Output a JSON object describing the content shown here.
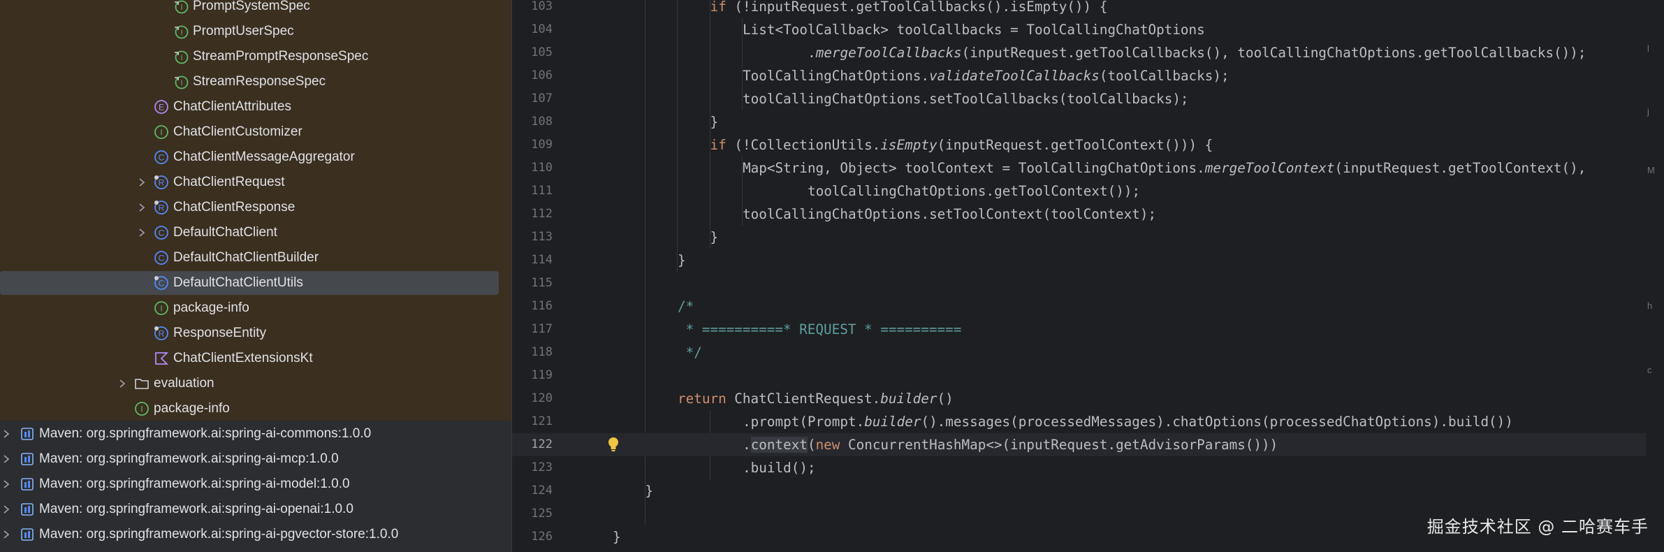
{
  "project_tree": {
    "items": [
      {
        "label": "PromptSystemSpec",
        "icon": "spec-class-icon",
        "depth": 4,
        "chevron": false
      },
      {
        "label": "PromptUserSpec",
        "icon": "spec-class-icon",
        "depth": 4,
        "chevron": false
      },
      {
        "label": "StreamPromptResponseSpec",
        "icon": "spec-class-icon",
        "depth": 4,
        "chevron": false
      },
      {
        "label": "StreamResponseSpec",
        "icon": "spec-class-icon",
        "depth": 4,
        "chevron": false
      },
      {
        "label": "ChatClientAttributes",
        "icon": "enum-icon",
        "depth": 3,
        "chevron": false
      },
      {
        "label": "ChatClientCustomizer",
        "icon": "interface-icon",
        "depth": 3,
        "chevron": false
      },
      {
        "label": "ChatClientMessageAggregator",
        "icon": "class-icon",
        "depth": 3,
        "chevron": false
      },
      {
        "label": "ChatClientRequest",
        "icon": "record-icon",
        "depth": 3,
        "chevron": true
      },
      {
        "label": "ChatClientResponse",
        "icon": "record-icon",
        "depth": 3,
        "chevron": true
      },
      {
        "label": "DefaultChatClient",
        "icon": "class-icon",
        "depth": 3,
        "chevron": true
      },
      {
        "label": "DefaultChatClientBuilder",
        "icon": "class-icon",
        "depth": 3,
        "chevron": false
      },
      {
        "label": "DefaultChatClientUtils",
        "icon": "final-class-icon",
        "depth": 3,
        "chevron": false,
        "selected": true
      },
      {
        "label": "package-info",
        "icon": "interface-icon",
        "depth": 3,
        "chevron": false
      },
      {
        "label": "ResponseEntity",
        "icon": "record-icon",
        "depth": 3,
        "chevron": false
      },
      {
        "label": "ChatClientExtensionsKt",
        "icon": "kotlin-file-icon",
        "depth": 3,
        "chevron": false
      },
      {
        "label": "evaluation",
        "icon": "folder-icon",
        "depth": 2,
        "chevron": true
      },
      {
        "label": "package-info",
        "icon": "interface-icon",
        "depth": 2,
        "chevron": false
      }
    ],
    "libraries": [
      {
        "label": "Maven: org.springframework.ai:spring-ai-commons:1.0.0",
        "icon": "library-icon"
      },
      {
        "label": "Maven: org.springframework.ai:spring-ai-mcp:1.0.0",
        "icon": "library-icon"
      },
      {
        "label": "Maven: org.springframework.ai:spring-ai-model:1.0.0",
        "icon": "library-icon"
      },
      {
        "label": "Maven: org.springframework.ai:spring-ai-openai:1.0.0",
        "icon": "library-icon"
      },
      {
        "label": "Maven: org.springframework.ai:spring-ai-pgvector-store:1.0.0",
        "icon": "library-icon"
      }
    ]
  },
  "editor": {
    "current_line": "122",
    "syntax_colors": {
      "plain": "#bcbec4",
      "keyword": "#cf8e6d",
      "comment": "#5f826b",
      "doc": "#5f9ea0",
      "doc_tag": "#67a37c"
    },
    "lines": [
      {
        "n": "103",
        "indent": 3,
        "tokens": [
          {
            "t": "if",
            "c": "keyword"
          },
          {
            "t": " (!inputRequest.getToolCallbacks().isEmpty()) {"
          }
        ]
      },
      {
        "n": "104",
        "indent": 4,
        "tokens": [
          {
            "t": "List<ToolCallback> toolCallbacks = ToolCallingChatOptions"
          }
        ]
      },
      {
        "n": "105",
        "indent": 6,
        "tokens": [
          {
            "t": "."
          },
          {
            "t": "mergeToolCallbacks",
            "c": "italic"
          },
          {
            "t": "(inputRequest.getToolCallbacks(), toolCallingChatOptions.getToolCallbacks());"
          }
        ]
      },
      {
        "n": "106",
        "indent": 4,
        "tokens": [
          {
            "t": "ToolCallingChatOptions."
          },
          {
            "t": "validateToolCallbacks",
            "c": "italic"
          },
          {
            "t": "(toolCallbacks);"
          }
        ]
      },
      {
        "n": "107",
        "indent": 4,
        "tokens": [
          {
            "t": "toolCallingChatOptions.setToolCallbacks(toolCallbacks);"
          }
        ]
      },
      {
        "n": "108",
        "indent": 3,
        "tokens": [
          {
            "t": "}"
          }
        ]
      },
      {
        "n": "109",
        "indent": 3,
        "tokens": [
          {
            "t": "if",
            "c": "keyword"
          },
          {
            "t": " (!CollectionUtils."
          },
          {
            "t": "isEmpty",
            "c": "italic"
          },
          {
            "t": "(inputRequest.getToolContext())) {"
          }
        ]
      },
      {
        "n": "110",
        "indent": 4,
        "tokens": [
          {
            "t": "Map<String, Object> toolContext = ToolCallingChatOptions."
          },
          {
            "t": "mergeToolContext",
            "c": "italic"
          },
          {
            "t": "(inputRequest.getToolContext(),"
          }
        ]
      },
      {
        "n": "111",
        "indent": 6,
        "tokens": [
          {
            "t": "toolCallingChatOptions.getToolContext());"
          }
        ]
      },
      {
        "n": "112",
        "indent": 4,
        "tokens": [
          {
            "t": "toolCallingChatOptions.setToolContext(toolContext);"
          }
        ]
      },
      {
        "n": "113",
        "indent": 3,
        "tokens": [
          {
            "t": "}"
          }
        ]
      },
      {
        "n": "114",
        "indent": 2,
        "tokens": [
          {
            "t": "}"
          }
        ]
      },
      {
        "n": "115",
        "indent": 0,
        "tokens": []
      },
      {
        "n": "116",
        "indent": 2,
        "tokens": [
          {
            "t": "/*",
            "c": "doc"
          }
        ]
      },
      {
        "n": "117",
        "indent": 2,
        "tokens": [
          {
            "t": " * ==========* ",
            "c": "doc"
          },
          {
            "t": "REQUEST",
            "c": "doc"
          },
          {
            "t": " * ==========",
            "c": "doc"
          }
        ]
      },
      {
        "n": "118",
        "indent": 2,
        "tokens": [
          {
            "t": " */",
            "c": "doc"
          }
        ]
      },
      {
        "n": "119",
        "indent": 0,
        "tokens": []
      },
      {
        "n": "120",
        "indent": 2,
        "tokens": [
          {
            "t": "return",
            "c": "keyword"
          },
          {
            "t": " ChatClientRequest."
          },
          {
            "t": "builder",
            "c": "italic"
          },
          {
            "t": "()"
          }
        ]
      },
      {
        "n": "121",
        "indent": 4,
        "tokens": [
          {
            "t": ".prompt(Prompt."
          },
          {
            "t": "builder",
            "c": "italic"
          },
          {
            "t": "().messages(processedMessages).chatOptions(processedChatOptions).build())"
          }
        ]
      },
      {
        "n": "122",
        "indent": 4,
        "tokens": [
          {
            "t": "."
          },
          {
            "t": "context",
            "c": "highlight"
          },
          {
            "t": "("
          },
          {
            "t": "new",
            "c": "keyword"
          },
          {
            "t": " ConcurrentHashMap<>(inputRequest.getAdvisorParams()))"
          }
        ]
      },
      {
        "n": "123",
        "indent": 4,
        "tokens": [
          {
            "t": ".build();"
          }
        ]
      },
      {
        "n": "124",
        "indent": 1,
        "tokens": [
          {
            "t": "}"
          }
        ]
      },
      {
        "n": "125",
        "indent": 0,
        "tokens": []
      },
      {
        "n": "126",
        "indent": 0,
        "tokens": [
          {
            "t": "}"
          }
        ]
      }
    ]
  },
  "right_strip_glyphs": [
    "l",
    "j",
    "M",
    "h",
    "c"
  ],
  "watermark": "掘金技术社区 @ 二哈赛车手"
}
